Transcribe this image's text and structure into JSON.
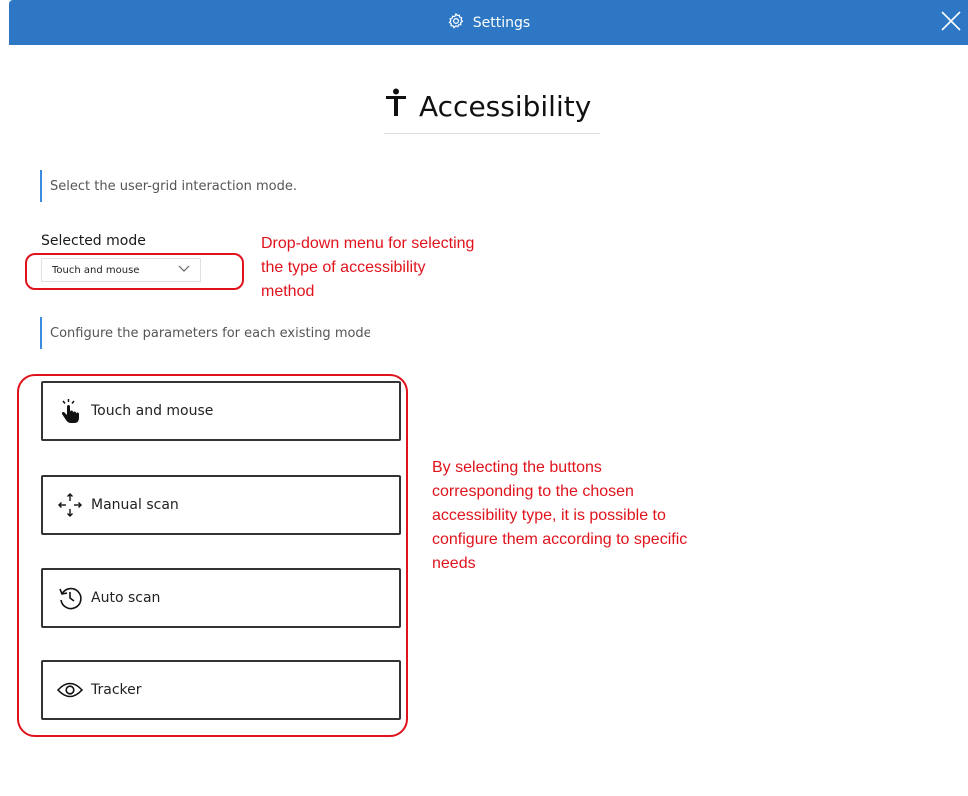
{
  "titlebar": {
    "title": "Settings",
    "icon": "gear-icon",
    "close_icon": "close-icon",
    "color": "#2d77c4"
  },
  "page": {
    "title": "Accessibility",
    "icon": "accessibility-person-icon"
  },
  "sections": {
    "interaction_hint": "Select the user-grid interaction mode.",
    "configure_hint": "Configure the parameters for each existing mode."
  },
  "mode_select": {
    "label": "Selected mode",
    "value": "Touch and mouse"
  },
  "mode_buttons": [
    {
      "label": "Touch and mouse",
      "icon": "touch-hand-icon"
    },
    {
      "label": "Manual scan",
      "icon": "move-arrows-icon"
    },
    {
      "label": "Auto scan",
      "icon": "history-clock-icon"
    },
    {
      "label": "Tracker",
      "icon": "eye-icon"
    }
  ],
  "annotations": {
    "dropdown_note": "Drop-down menu for selecting the type of accessibility method",
    "buttons_note": "By selecting the buttons corresponding to the chosen accessibility type, it is possible to configure them according to specific needs",
    "color": "#e0131d"
  }
}
